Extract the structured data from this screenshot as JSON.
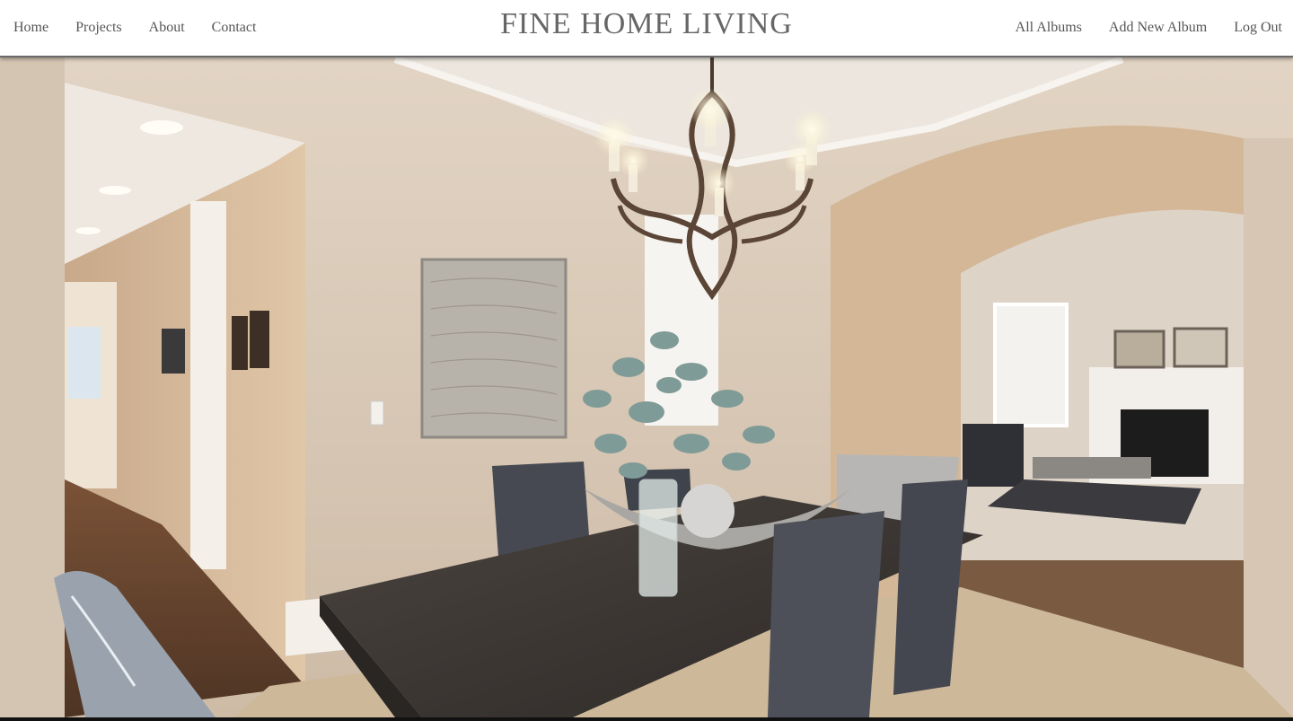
{
  "nav": {
    "left": [
      {
        "label": "Home"
      },
      {
        "label": "Projects"
      },
      {
        "label": "About"
      },
      {
        "label": "Contact"
      }
    ],
    "brand": "FINE HOME LIVING",
    "right": [
      {
        "label": "All Albums"
      },
      {
        "label": "Add New Album"
      },
      {
        "label": "Log Out"
      }
    ]
  },
  "hero": {
    "subject": "dining-room-photo",
    "colors": {
      "wall": "#d8c8b6",
      "ceiling": "#ece6de",
      "floor": "#6b4a33",
      "table": "#3d3835",
      "chair": "#4a4d55",
      "carpet": "#cdb89a"
    }
  }
}
